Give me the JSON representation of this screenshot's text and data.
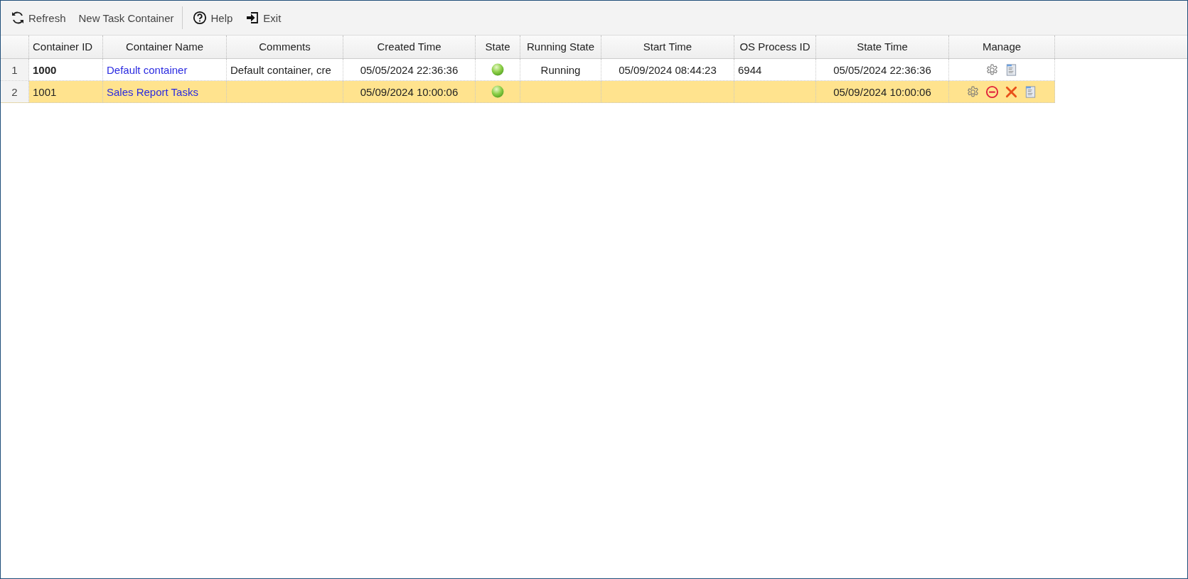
{
  "toolbar": {
    "groups": [
      [
        {
          "kind": "refresh",
          "label": "Refresh"
        },
        {
          "kind": "plain",
          "label": "New Task Container"
        }
      ],
      [
        {
          "kind": "help",
          "label": "Help"
        },
        {
          "kind": "exit",
          "label": "Exit"
        }
      ]
    ]
  },
  "table": {
    "columns": [
      {
        "label": "Container ID"
      },
      {
        "label": "Container Name"
      },
      {
        "label": "Comments"
      },
      {
        "label": "Created Time"
      },
      {
        "label": "State"
      },
      {
        "label": "Running State"
      },
      {
        "label": "Start Time"
      },
      {
        "label": "OS Process ID"
      },
      {
        "label": "State Time"
      },
      {
        "label": "Manage"
      }
    ],
    "rows": [
      {
        "number": "1",
        "selected": false,
        "id": "1000",
        "id_bold": true,
        "name": "Default container",
        "comments": "Default container, cre",
        "created": "05/05/2024 22:36:36",
        "active": true,
        "running_state": "Running",
        "start_time": "05/09/2024 08:44:23",
        "pid": "6944",
        "state_time": "05/05/2024 22:36:36",
        "actions": [
          {
            "kind": "settings"
          },
          {
            "kind": "log"
          }
        ]
      },
      {
        "number": "2",
        "selected": true,
        "id": "1001",
        "id_bold": false,
        "name": "Sales Report Tasks",
        "created": "05/09/2024 10:00:06",
        "active": true,
        "state_time": "05/09/2024 10:00:06",
        "actions": [
          {
            "kind": "settings"
          },
          {
            "kind": "stop"
          },
          {
            "kind": "delete"
          },
          {
            "kind": "log"
          }
        ]
      }
    ]
  }
}
